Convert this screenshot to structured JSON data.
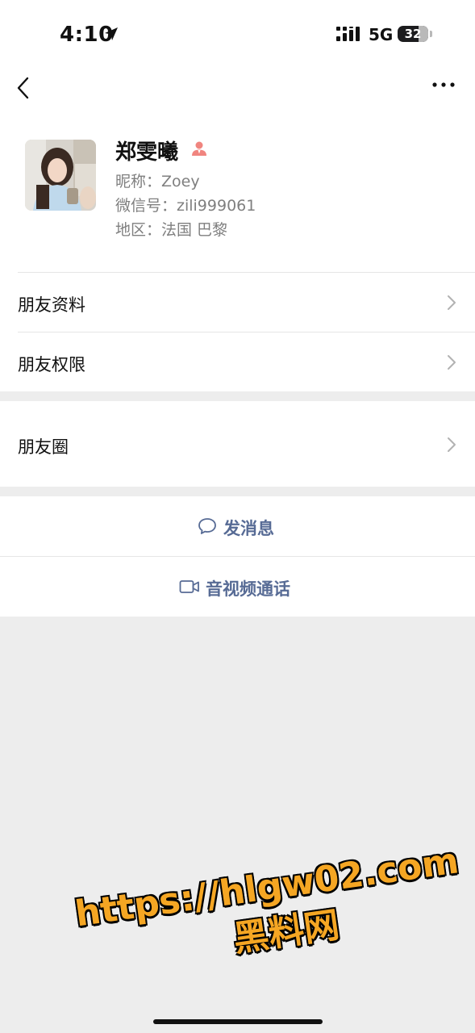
{
  "status_bar": {
    "time": "4:10",
    "network": "5G",
    "battery": "32",
    "battery_level": 0.32
  },
  "nav": {
    "back_icon": "chevron-left-icon",
    "more_icon": "ellipsis-icon"
  },
  "profile": {
    "name": "郑雯曦",
    "nickname": "昵称：Zoey",
    "wechat_id": "微信号：zili999061",
    "region": "地区：法国 巴黎",
    "contact_icon_color": "#f0857f"
  },
  "menu": {
    "friend_info": "朋友资料",
    "friend_permissions": "朋友权限",
    "moments": "朋友圈"
  },
  "actions": {
    "send_message": "发消息",
    "video_call": "音视频通话"
  },
  "colors": {
    "accent": "#576b95",
    "background": "#ededed"
  },
  "watermark": {
    "line1": "https://hlgw02.com",
    "line2": "黑料网"
  }
}
